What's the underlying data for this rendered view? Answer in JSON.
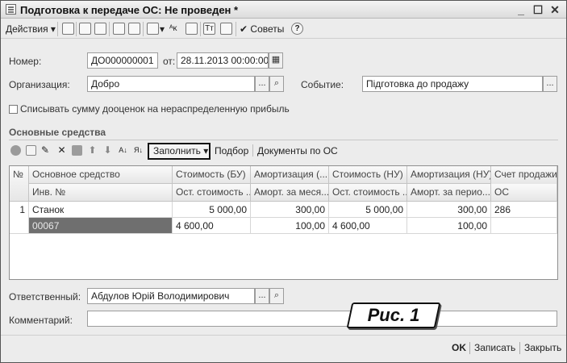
{
  "window": {
    "title": "Подготовка к передаче ОС: Не проведен *",
    "controls": {
      "minimize": "_",
      "maximize": "☐",
      "close": "✕"
    }
  },
  "toolbar": {
    "actions_label": "Действия",
    "advice_label": "Советы",
    "help_glyph": "?"
  },
  "form": {
    "number_label": "Номер:",
    "number_value": "ДО000000001",
    "date_label": "от:",
    "date_value": "28.11.2013 00:00:00",
    "org_label": "Организация:",
    "org_value": "Добро",
    "event_label": "Событие:",
    "event_value": "Підготовка до продажу",
    "checkbox_label": "Списывать сумму дооценок на нераспределенную прибыль",
    "select_button": "...",
    "search_glyph": "🔍"
  },
  "section": {
    "title": "Основные средства",
    "fill_label": "Заполнить",
    "pick_label": "Подбор",
    "docs_label": "Документы по ОС"
  },
  "table": {
    "headers_top": [
      "№",
      "Основное средство",
      "Стоимость (БУ)",
      "Амортизация (...",
      "Стоимость (НУ)",
      "Амортизация (НУ)",
      "Счет продажи"
    ],
    "headers_bottom": [
      "",
      "Инв. №",
      "Ост. стоимость ...",
      "Аморт. за меся...",
      "Ост. стоимость ...",
      "Аморт. за перио...",
      "ОС"
    ],
    "rows": [
      {
        "top": [
          "1",
          "Станок",
          "5 000,00",
          "300,00",
          "5 000,00",
          "300,00",
          "286"
        ],
        "bottom": [
          "",
          "00067",
          "4 600,00",
          "100,00",
          "4 600,00",
          "100,00",
          ""
        ]
      }
    ]
  },
  "footer_form": {
    "responsible_label": "Ответственный:",
    "responsible_value": "Абдулов Юрій Володимирович",
    "comment_label": "Комментарий:",
    "comment_value": ""
  },
  "bottom": {
    "ok": "OK",
    "save": "Записать",
    "close": "Закрыть"
  },
  "caption": "Рис. 1"
}
